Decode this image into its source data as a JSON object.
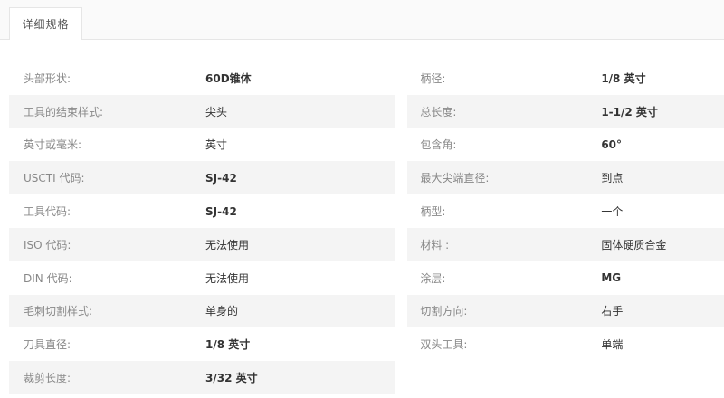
{
  "tab": {
    "label": "详细规格"
  },
  "left_rows": [
    {
      "label": "头部形状:",
      "value": "60D锥体",
      "bold": true
    },
    {
      "label": "工具的结束样式:",
      "value": "尖头",
      "bold": false
    },
    {
      "label": "英寸或毫米:",
      "value": "英寸",
      "bold": false
    },
    {
      "label": "USCTI 代码:",
      "value": "SJ-42",
      "bold": true
    },
    {
      "label": "工具代码:",
      "value": "SJ-42",
      "bold": true
    },
    {
      "label": "ISO 代码:",
      "value": "无法使用",
      "bold": false
    },
    {
      "label": "DIN 代码:",
      "value": "无法使用",
      "bold": false
    },
    {
      "label": "毛刺切割样式:",
      "value": "单身的",
      "bold": false
    },
    {
      "label": "刀具直径:",
      "value": "1/8 英寸",
      "bold": true
    },
    {
      "label": "裁剪长度:",
      "value": "3/32 英寸",
      "bold": true
    }
  ],
  "right_rows": [
    {
      "label": "柄径:",
      "value": "1/8 英寸",
      "bold": true
    },
    {
      "label": "总长度:",
      "value": "1-1/2 英寸",
      "bold": true
    },
    {
      "label": "包含角:",
      "value": "60°",
      "bold": true
    },
    {
      "label": "最大尖端直径:",
      "value": "到点",
      "bold": false
    },
    {
      "label": "柄型:",
      "value": "一个",
      "bold": false
    },
    {
      "label": "材料 :",
      "value": "固体硬质合金",
      "bold": false
    },
    {
      "label": "涂层:",
      "value": "MG",
      "bold": true
    },
    {
      "label": "切割方向:",
      "value": "右手",
      "bold": false
    },
    {
      "label": "双头工具:",
      "value": "单端",
      "bold": false
    }
  ]
}
